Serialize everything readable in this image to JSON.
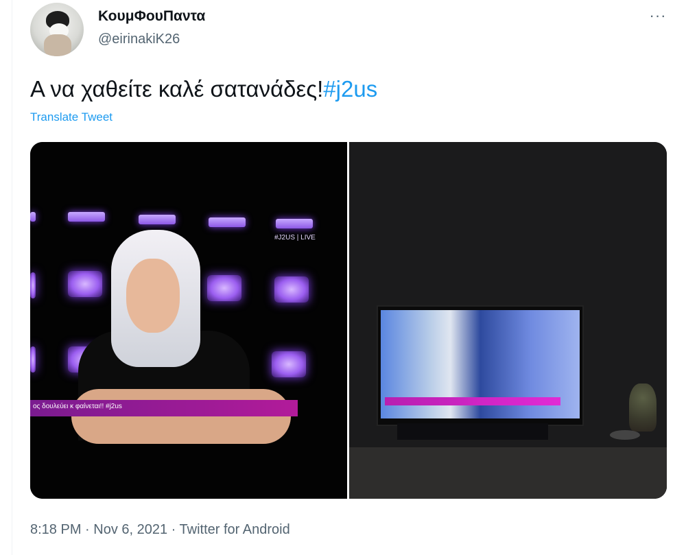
{
  "tweet": {
    "author": {
      "display_name": "ΚουμΦουΠαντα",
      "handle": "@eirinakiK26",
      "avatar_icon": "panda-avatar"
    },
    "text": "Α να χαθείτε καλέ σατανάδες!",
    "hashtag": "#j2us",
    "translate_label": "Translate Tweet",
    "timestamp": "8:18 PM · Nov 6, 2021 · Twitter for Android",
    "menu_icon": "more-horizontal-icon",
    "media": {
      "left_photo": {
        "live_badge": "#J2US | LIVE",
        "lower_third_text": "ος δουλεύει κ φαίνεται!! #j2us"
      }
    }
  },
  "colors": {
    "link": "#1d9bf0",
    "secondary_text": "#536471",
    "primary_text": "#0f1419"
  }
}
